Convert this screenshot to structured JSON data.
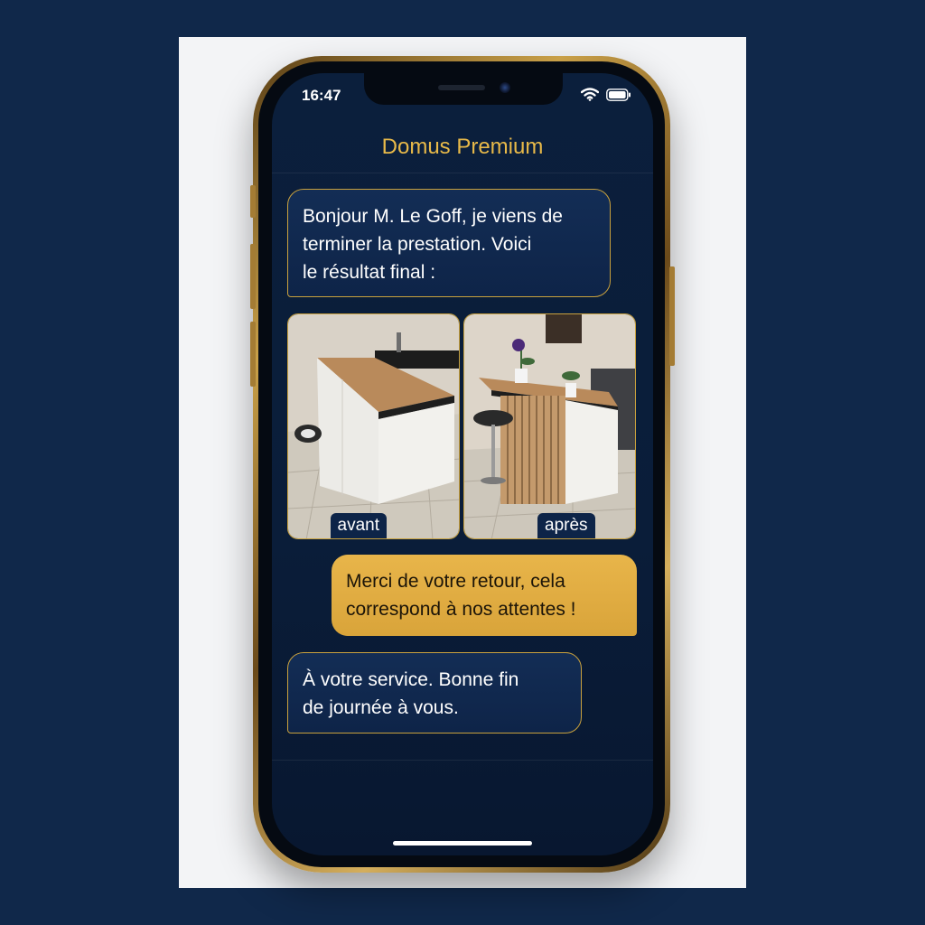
{
  "status_bar": {
    "time": "16:47",
    "icons": [
      "wifi-icon",
      "battery-icon"
    ]
  },
  "header": {
    "title": "Domus Premium"
  },
  "messages": [
    {
      "sender": "incoming",
      "text": "Bonjour M. Le Goff, je viens de\nterminer la prestation. Voici\nle résultat final :"
    },
    {
      "sender": "outgoing",
      "text": "Merci de votre retour, cela\ncorrespond à nos attentes !"
    },
    {
      "sender": "incoming",
      "text": "À votre service. Bonne fin\nde journée à vous."
    }
  ],
  "photos": [
    {
      "label": "avant"
    },
    {
      "label": "après"
    }
  ],
  "colors": {
    "background": "#10284a",
    "accent_gold": "#e8b949",
    "outgoing_bubble": "#deaa40",
    "incoming_bubble": "#112a50"
  }
}
